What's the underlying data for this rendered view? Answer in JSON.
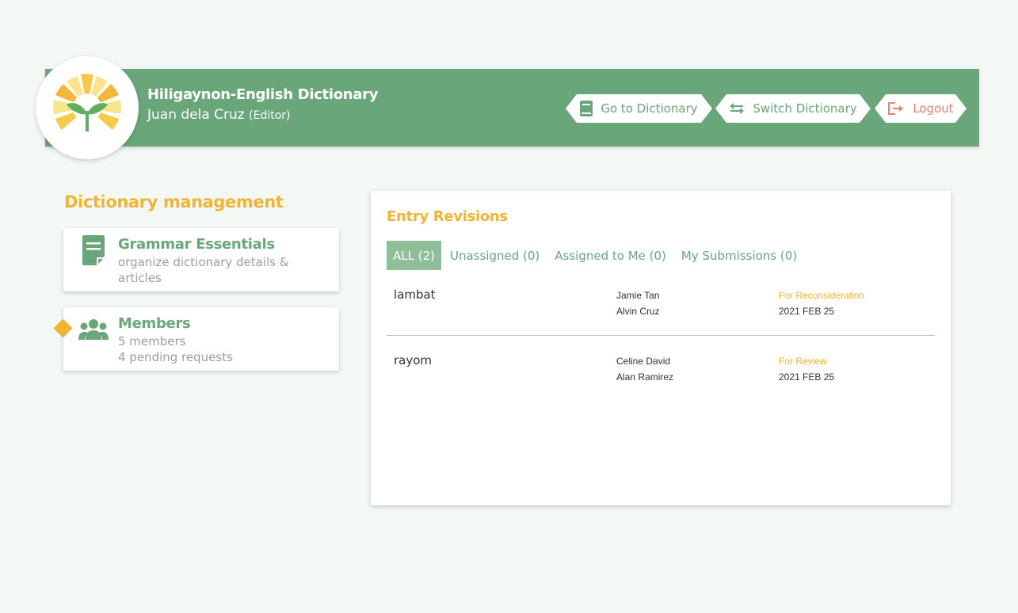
{
  "header": {
    "title": "Hiligaynon-English Dictionary",
    "user_name": "Juan dela Cruz",
    "user_role": "(Editor)",
    "buttons": {
      "go_to_dictionary": "Go to Dictionary",
      "switch_dictionary": "Switch Dictionary",
      "logout": "Logout"
    }
  },
  "sidebar": {
    "title": "Dictionary management",
    "cards": [
      {
        "title": "Grammar Essentials",
        "desc": "organize dictionary details & articles"
      },
      {
        "title": "Members",
        "line1": "5 members",
        "line2": "4 pending requests"
      }
    ]
  },
  "revisions": {
    "title": "Entry Revisions",
    "tabs": [
      "ALL (2)",
      "Unassigned (0)",
      "Assigned to Me (0)",
      "My Submissions (0)"
    ],
    "rows": [
      {
        "word": "lambat",
        "author": "Jamie Tan",
        "reviewer": "Alvin Cruz",
        "status": "For Reconsideration",
        "date": "2021 FEB 25"
      },
      {
        "word": "rayom",
        "author": "Celine David",
        "reviewer": "Alan Ramirez",
        "status": "For Review",
        "date": "2021 FEB 25"
      }
    ]
  },
  "colors": {
    "primary_green": "#69a77b",
    "accent_yellow": "#f2b533",
    "logout_red": "#ee7f6b",
    "active_tab": "#8fbf99"
  },
  "icons": [
    "logo-icon",
    "book-icon",
    "swap-arrows-icon",
    "logout-icon",
    "document-icon",
    "people-icon"
  ]
}
